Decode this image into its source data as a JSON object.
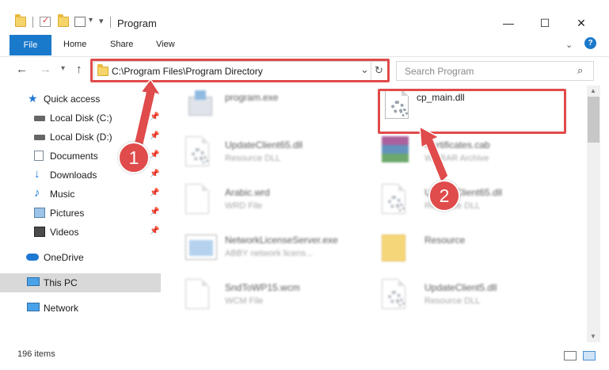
{
  "window": {
    "title": "Program",
    "minimize_glyph": "—",
    "maximize_glyph": "☐",
    "close_glyph": "✕"
  },
  "ribbon": {
    "tabs": [
      "File",
      "Home",
      "Share",
      "View"
    ],
    "help_glyph": "?"
  },
  "address": {
    "path": "C:\\Program Files\\Program Directory",
    "refresh_glyph": "↻",
    "dropdown_glyph": "⌄"
  },
  "search": {
    "placeholder": "Search Program"
  },
  "sidebar": {
    "items": [
      {
        "label": "Quick access",
        "icon": "star-icon",
        "pinned": false
      },
      {
        "label": "Local Disk (C:)",
        "icon": "drive-icon",
        "pinned": true
      },
      {
        "label": "Local Disk (D:)",
        "icon": "drive-icon",
        "pinned": true
      },
      {
        "label": "Documents",
        "icon": "documents-icon",
        "pinned": true
      },
      {
        "label": "Downloads",
        "icon": "download-icon",
        "pinned": true
      },
      {
        "label": "Music",
        "icon": "music-icon",
        "pinned": true
      },
      {
        "label": "Pictures",
        "icon": "pictures-icon",
        "pinned": true
      },
      {
        "label": "Videos",
        "icon": "videos-icon",
        "pinned": true
      },
      {
        "label": "OneDrive",
        "icon": "cloud-icon",
        "pinned": false
      },
      {
        "label": "This PC",
        "icon": "computer-icon",
        "pinned": false,
        "selected": true
      },
      {
        "label": "Network",
        "icon": "network-icon",
        "pinned": false
      }
    ]
  },
  "files": [
    {
      "name": "program.exe",
      "type": "",
      "icon": "installer-icon",
      "blurred": true
    },
    {
      "name": "cp_main.dll",
      "type": "",
      "icon": "dll-icon",
      "blurred": false
    },
    {
      "name": "UpdateClient65.dll",
      "type": "Resource DLL",
      "icon": "dll-icon",
      "blurred": true
    },
    {
      "name": "Certificates.cab",
      "type": "WinRAR Archive",
      "icon": "archive-icon",
      "blurred": true
    },
    {
      "name": "Arabic.wrd",
      "type": "WRD File",
      "icon": "file-icon",
      "blurred": true
    },
    {
      "name": "UpdateClient65.dll",
      "type": "Resource DLL",
      "icon": "dll-icon",
      "blurred": true
    },
    {
      "name": "NetworkLicenseServer.exe",
      "type": "ABBY network licens...",
      "icon": "app-icon",
      "blurred": true
    },
    {
      "name": "Resource",
      "type": "",
      "icon": "folder-icon",
      "blurred": true
    },
    {
      "name": "SndToWP15.wcm",
      "type": "WCM File",
      "icon": "file-icon",
      "blurred": true
    },
    {
      "name": "UpdateClient5.dll",
      "type": "Resource DLL",
      "icon": "dll-icon",
      "blurred": true
    }
  ],
  "callouts": [
    "1",
    "2"
  ],
  "status": {
    "item_count": "196 items"
  },
  "colors": {
    "accent": "#1979ca",
    "callout": "#e04b4b",
    "selected": "#d9d9d9"
  }
}
